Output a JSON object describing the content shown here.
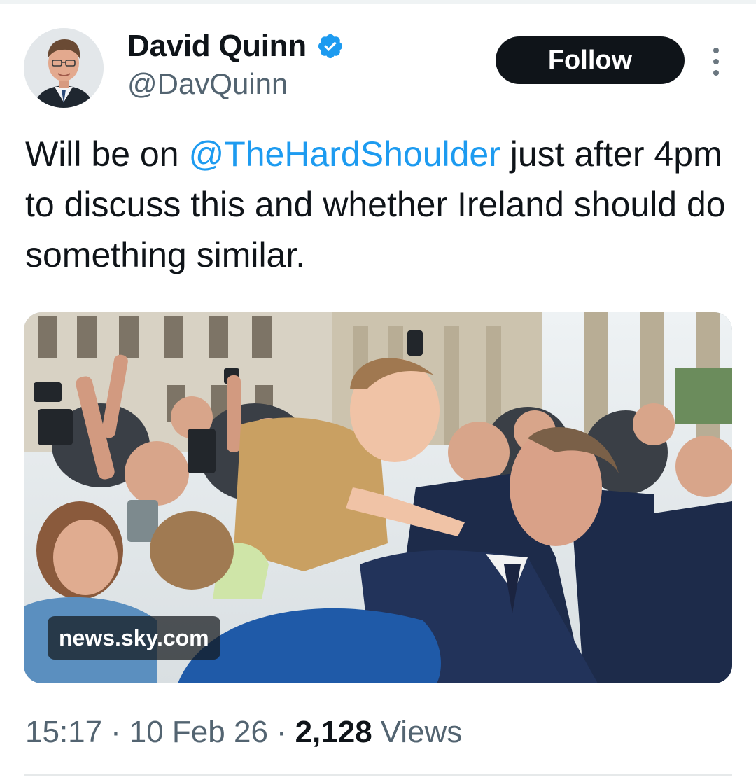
{
  "author": {
    "display_name": "David Quinn",
    "handle": "@DavQuinn",
    "verified": true,
    "verified_color": "#1d9bf0"
  },
  "actions": {
    "follow_label": "Follow",
    "more_icon": "more-vertical-icon"
  },
  "tweet": {
    "text_before": "Will be on ",
    "mention": "@TheHardShoulder",
    "text_after": " just after 4pm to discuss this and whether Ireland should do something similar."
  },
  "media": {
    "source": "news.sky.com"
  },
  "meta": {
    "time": "15:17",
    "date": "10 Feb 26",
    "views_count": "2,128",
    "views_label": "Views",
    "separator": "·"
  },
  "colors": {
    "accent": "#1d9bf0",
    "text": "#0f1419",
    "muted": "#536471"
  }
}
